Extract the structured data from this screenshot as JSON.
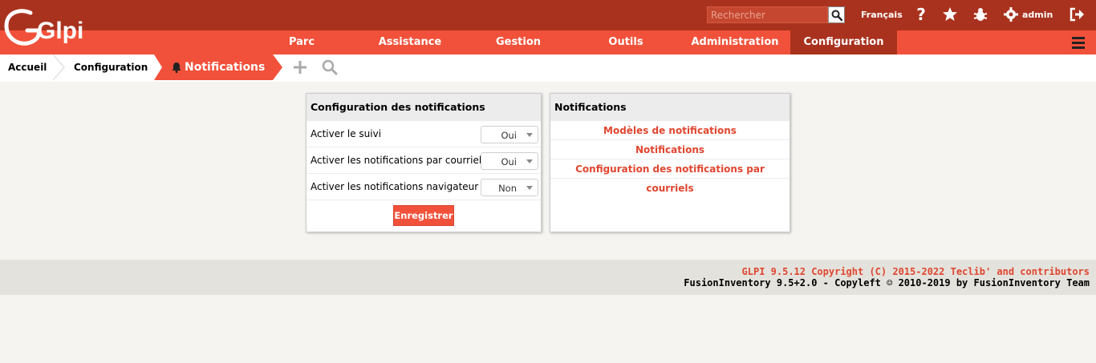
{
  "header": {
    "logo_text": "Glpi",
    "search_placeholder": "Rechercher",
    "language": "Français",
    "user": "admin"
  },
  "icons": {
    "search": "search-icon",
    "help": "help-icon",
    "favorites": "star-icon",
    "debug": "bug-icon",
    "settings": "gear-icon",
    "logout": "logout-icon",
    "menu": "hamburger-icon",
    "notification": "bell-icon",
    "add": "plus-icon",
    "find": "search-icon"
  },
  "menu": {
    "items": [
      {
        "label": "Parc"
      },
      {
        "label": "Assistance"
      },
      {
        "label": "Gestion"
      },
      {
        "label": "Outils"
      },
      {
        "label": "Administration"
      },
      {
        "label": "Configuration",
        "active": true
      }
    ]
  },
  "breadcrumb": {
    "home": "Accueil",
    "section": "Configuration",
    "current": "Notifications"
  },
  "config_panel": {
    "title": "Configuration des notifications",
    "rows": [
      {
        "label": "Activer le suivi",
        "value": "Oui"
      },
      {
        "label": "Activer les notifications par courriel",
        "value": "Oui"
      },
      {
        "label": "Activer les notifications navigateur",
        "value": "Non"
      }
    ],
    "save_label": "Enregistrer"
  },
  "notif_panel": {
    "title": "Notifications",
    "links": [
      "Modèles de notifications",
      "Notifications",
      "Configuration des notifications par courriels"
    ]
  },
  "footer": {
    "line1": "GLPI 9.5.12 Copyright (C) 2015-2022 Teclib' and contributors",
    "line2": "FusionInventory 9.5+2.0 - Copyleft ☺ 2010-2019 by FusionInventory Team"
  },
  "colors": {
    "header_dark": "#a9321e",
    "menu_orange": "#f1513a",
    "link_red": "#e0462f",
    "background": "#f5f4f0"
  }
}
